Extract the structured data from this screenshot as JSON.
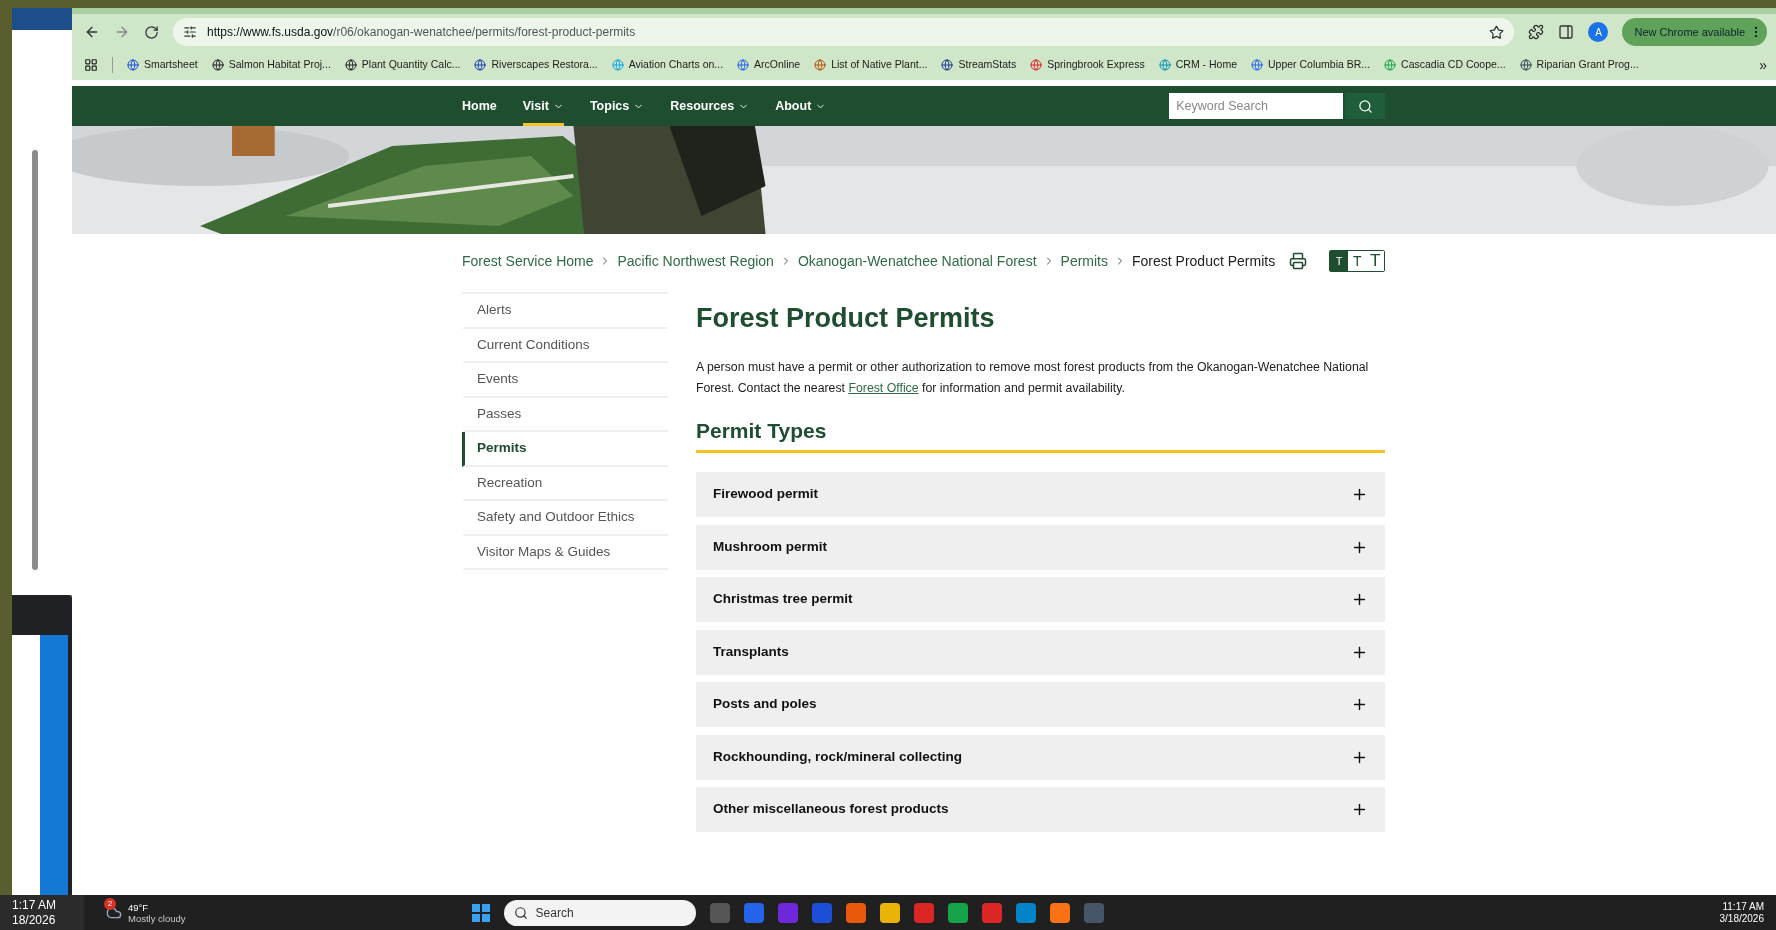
{
  "browser": {
    "url_host": "https://www.fs.usda.gov",
    "url_path": "/r06/okanogan-wenatchee/permits/forest-product-permits",
    "profile_initial": "A",
    "update_button": "New Chrome available",
    "bookmarks": [
      "Smartsheet",
      "Salmon Habitat Proj...",
      "Plant Quantity Calc...",
      "Riverscapes Restora...",
      "Aviation Charts on...",
      "ArcOnline",
      "List of Native Plant...",
      "StreamStats",
      "Springbrook Express",
      "CRM - Home",
      "Upper Columbia BR...",
      "Cascadia CD Coope...",
      "Riparian Grant Prog..."
    ],
    "more_bookmarks": "»"
  },
  "nav": {
    "items": [
      {
        "label": "Home",
        "dropdown": false,
        "selected": false
      },
      {
        "label": "Visit",
        "dropdown": true,
        "selected": true
      },
      {
        "label": "Topics",
        "dropdown": true,
        "selected": false
      },
      {
        "label": "Resources",
        "dropdown": true,
        "selected": false
      },
      {
        "label": "About",
        "dropdown": true,
        "selected": false
      }
    ],
    "search": {
      "placeholder": "Keyword Search"
    }
  },
  "breadcrumb": [
    "Forest Service Home",
    "Pacific Northwest Region",
    "Okanogan-Wenatchee National Forest",
    "Permits",
    "Forest Product Permits"
  ],
  "text_size_options": [
    {
      "label": "T",
      "selected": true
    },
    {
      "label": "T",
      "selected": false
    },
    {
      "label": "T",
      "selected": false
    }
  ],
  "sidebar": [
    {
      "label": "Alerts",
      "selected": false
    },
    {
      "label": "Current Conditions",
      "selected": false
    },
    {
      "label": "Events",
      "selected": false
    },
    {
      "label": "Passes",
      "selected": false
    },
    {
      "label": "Permits",
      "selected": true
    },
    {
      "label": "Recreation",
      "selected": false
    },
    {
      "label": "Safety and Outdoor Ethics",
      "selected": false
    },
    {
      "label": "Visitor Maps & Guides",
      "selected": false
    }
  ],
  "page": {
    "title": "Forest Product Permits",
    "intro_before": "A person must have a permit or other authorization to remove most forest products from the Okanogan-Wenatchee National Forest. Contact the nearest",
    "intro_link": "Forest Office",
    "intro_after": "for information and permit availability.",
    "section_title": "Permit Types",
    "accordion": [
      {
        "label": "Firewood permit",
        "expanded": false
      },
      {
        "label": "Mushroom permit",
        "expanded": false
      },
      {
        "label": "Christmas tree permit",
        "expanded": false
      },
      {
        "label": "Transplants",
        "expanded": false
      },
      {
        "label": "Posts and poles",
        "expanded": false
      },
      {
        "label": "Rockhounding, rock/mineral collecting",
        "expanded": false
      },
      {
        "label": "Other miscellaneous forest products",
        "expanded": false
      }
    ]
  },
  "left_window": {
    "time": "1:17 AM",
    "date": "18/2026"
  },
  "taskbar": {
    "weather_badge": "2",
    "temperature": "49°F",
    "weather": "Mostly cloudy",
    "search_placeholder": "Search",
    "time": "11:17 AM",
    "date": "3/18/2026"
  }
}
